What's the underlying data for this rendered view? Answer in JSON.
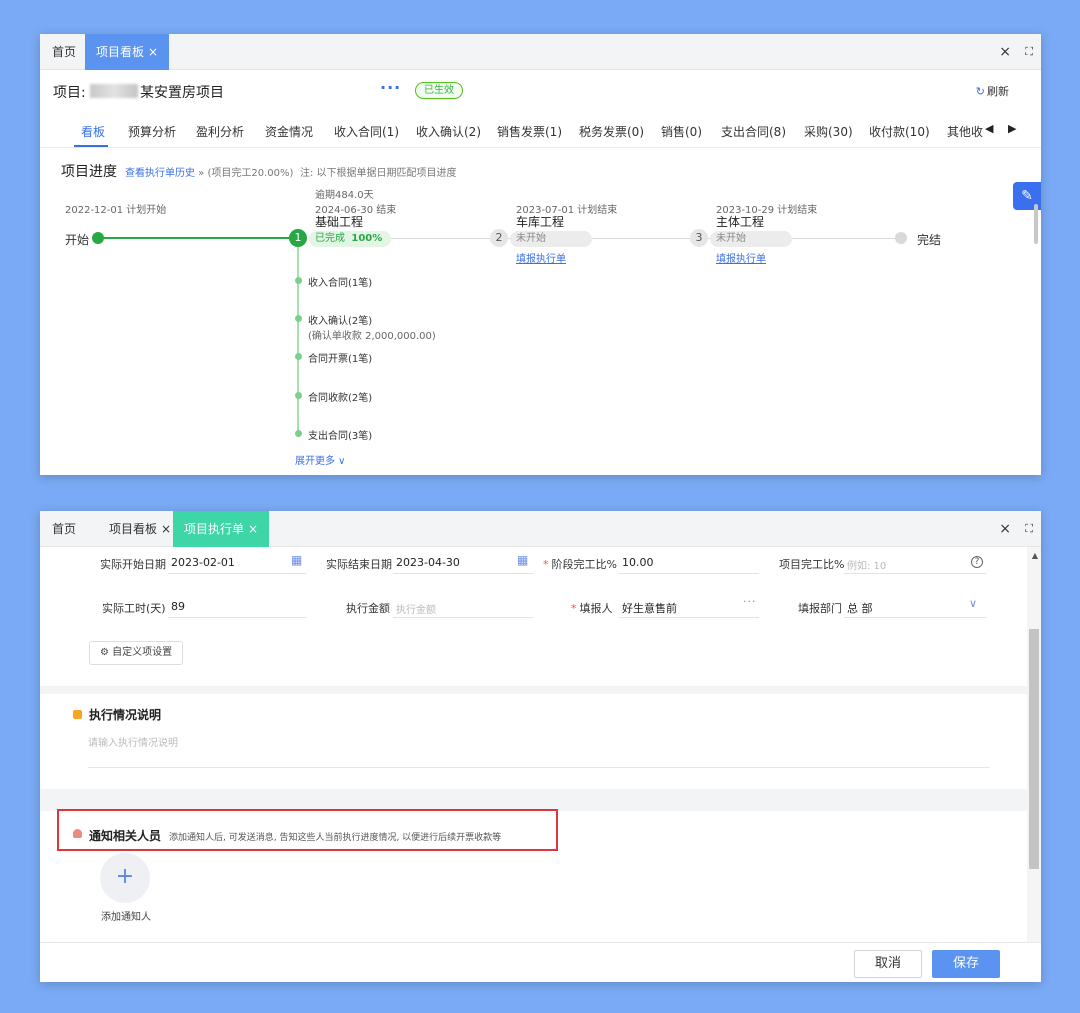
{
  "win1": {
    "tabs": [
      {
        "label": "首页"
      },
      {
        "label": "项目看板"
      }
    ],
    "tab_close": "×",
    "controls": {
      "close": "×",
      "maximize": "⛶"
    },
    "project_label": "项目:",
    "project_name": "某安置房项目",
    "more_dots": "···",
    "status_badge": "已生效",
    "refresh_label": "刷新",
    "subtabs": [
      "看板",
      "预算分析",
      "盈利分析",
      "资金情况",
      "收入合同(1)",
      "收入确认(2)",
      "销售发票(1)",
      "税务发票(0)",
      "销售(0)",
      "支出合同(8)",
      "采购(30)",
      "收付款(10)",
      "其他收"
    ],
    "arrows": {
      "left": "◀",
      "right": "▶"
    },
    "progress": {
      "title": "项目进度",
      "history_link": "查看执行单历史",
      "history_suffix": " » (项目完工20.00%)",
      "note": "注: 以下根据单据日期匹配项目进度",
      "start_date": "2022-12-01 计划开始",
      "start_label": "开始",
      "end_label": "完结",
      "expand_more": "展开更多 ∨",
      "stages": [
        {
          "num": "1",
          "overdue": "逾期484.0天",
          "date": "2024-06-30 结束",
          "name": "基础工程",
          "status": "已完成",
          "percent": "100%"
        },
        {
          "num": "2",
          "date": "2023-07-01 计划结束",
          "name": "车库工程",
          "status": "未开始",
          "link": "填报执行单"
        },
        {
          "num": "3",
          "date": "2023-10-29 计划结束",
          "name": "主体工程",
          "status": "未开始",
          "link": "填报执行单"
        }
      ],
      "items": [
        "收入合同(1笔)",
        "收入确认(2笔)",
        "合同开票(1笔)",
        "合同收款(2笔)",
        "支出合同(3笔)"
      ],
      "item_extra": "(确认单收款 2,000,000.00)"
    },
    "side_icon": "✎"
  },
  "win2": {
    "tabs": [
      {
        "label": "首页"
      },
      {
        "label": "项目看板"
      },
      {
        "label": "项目执行单"
      }
    ],
    "tab_close": "×",
    "controls": {
      "close": "×",
      "maximize": "⛶"
    },
    "form": {
      "start_date_label": "实际开始日期",
      "start_date": "2023-02-01",
      "end_date_label": "实际结束日期",
      "end_date": "2023-04-30",
      "stage_pct_label": "阶段完工比%",
      "stage_pct": "10.00",
      "proj_pct_label": "项目完工比%",
      "proj_pct_ph": "例如: 10",
      "days_label": "实际工时(天)",
      "days": "89",
      "amount_label": "执行金额",
      "amount_ph": "执行金额",
      "reporter_label": "填报人",
      "reporter": "好生意售前",
      "dept_label": "填报部门",
      "dept": "总 部",
      "required_mark": "*",
      "calendar_icon": "▦",
      "help_icon": "?",
      "dots": "···",
      "chevron": "∨"
    },
    "custom_btn": "⚙ 自定义项设置",
    "exec_title": "执行情况说明",
    "exec_placeholder": "请输入执行情况说明",
    "notify_title": "通知相关人员",
    "notify_desc": "添加通知人后, 可发送消息, 告知这些人当前执行进度情况, 以便进行后续开票收款等",
    "add_plus": "+",
    "add_label": "添加通知人",
    "cancel": "取消",
    "save": "保存",
    "scroll_up": "▲"
  },
  "colors": {
    "accent": "#3a70e6",
    "tab_active": "#5b93f1",
    "tab_active2": "#3ed6a6",
    "green": "#27a844",
    "red": "#e0353a"
  }
}
